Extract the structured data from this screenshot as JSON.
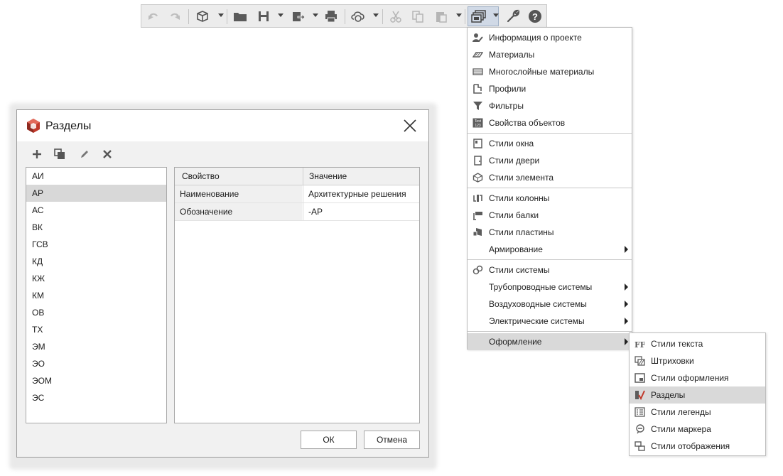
{
  "toolbar": {
    "icons": [
      "undo-icon",
      "redo-icon",
      "3d-view-icon",
      "open-folder-icon",
      "save-icon",
      "export-icon",
      "print-icon",
      "sync-icon",
      "cut-icon",
      "copy-icon",
      "paste-icon",
      "styles-icon",
      "wrench-icon",
      "help-icon"
    ]
  },
  "main_menu": {
    "items": [
      {
        "label": "Информация о проекте",
        "icon": "project-info-icon"
      },
      {
        "label": "Материалы",
        "icon": "materials-icon"
      },
      {
        "label": "Многослойные материалы",
        "icon": "multilayer-materials-icon"
      },
      {
        "label": "Профили",
        "icon": "profiles-icon"
      },
      {
        "label": "Фильтры",
        "icon": "filters-icon"
      },
      {
        "label": "Свойства объектов",
        "icon": "object-properties-icon"
      },
      {
        "label": "Стили окна",
        "icon": "window-styles-icon"
      },
      {
        "label": "Стили двери",
        "icon": "door-styles-icon"
      },
      {
        "label": "Стили элемента",
        "icon": "element-styles-icon"
      },
      {
        "label": "Стили колонны",
        "icon": "column-styles-icon"
      },
      {
        "label": "Стили балки",
        "icon": "beam-styles-icon"
      },
      {
        "label": "Стили пластины",
        "icon": "plate-styles-icon"
      },
      {
        "label": "Армирование",
        "icon": ""
      },
      {
        "label": "Стили системы",
        "icon": "system-styles-icon"
      },
      {
        "label": "Трубопроводные системы",
        "icon": ""
      },
      {
        "label": "Воздуховодные системы",
        "icon": ""
      },
      {
        "label": "Электрические системы",
        "icon": ""
      },
      {
        "label": "Оформление",
        "icon": ""
      }
    ]
  },
  "sub_menu": {
    "items": [
      {
        "label": "Стили текста",
        "icon": "text-styles-icon"
      },
      {
        "label": "Штриховки",
        "icon": "hatching-icon"
      },
      {
        "label": "Стили оформления",
        "icon": "design-styles-icon"
      },
      {
        "label": "Разделы",
        "icon": "sections-icon"
      },
      {
        "label": "Стили легенды",
        "icon": "legend-styles-icon"
      },
      {
        "label": "Стили маркера",
        "icon": "marker-styles-icon"
      },
      {
        "label": "Стили отображения",
        "icon": "display-styles-icon"
      }
    ]
  },
  "dialog": {
    "title": "Разделы",
    "sections": [
      "АИ",
      "АР",
      "АС",
      "ВК",
      "ГСВ",
      "КД",
      "КЖ",
      "КМ",
      "ОВ",
      "ТХ",
      "ЭМ",
      "ЭО",
      "ЭОМ",
      "ЭС"
    ],
    "selected": "АР",
    "grid": {
      "headers": {
        "property": "Свойство",
        "value": "Значение"
      },
      "rows": [
        {
          "name": "Наименование",
          "value": "Архитектурные решения"
        },
        {
          "name": "Обозначение",
          "value": "-АР"
        }
      ]
    },
    "ok_label": "ОК",
    "cancel_label": "Отмена"
  },
  "colors": {
    "accent_red": "#c0392b",
    "highlight": "#d9d9d9",
    "icon_gray": "#5c5c5c"
  }
}
